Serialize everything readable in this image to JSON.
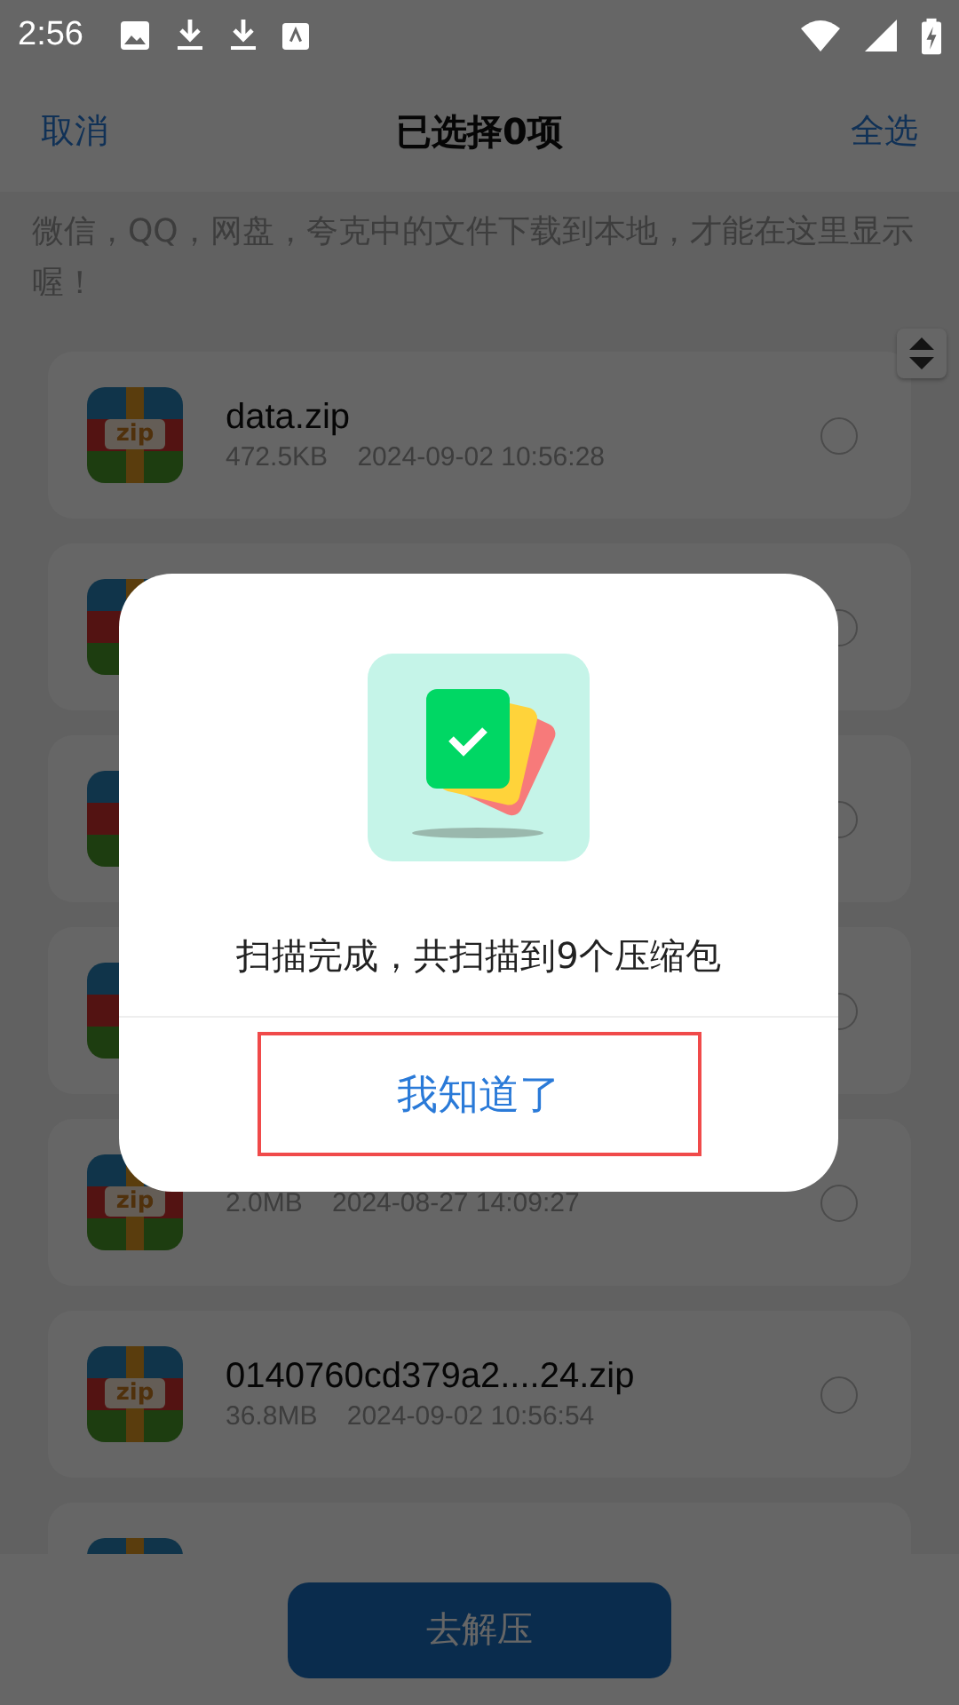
{
  "status_bar": {
    "time": "2:56"
  },
  "header": {
    "cancel": "取消",
    "title": "已选择0项",
    "select_all": "全选"
  },
  "notice": "微信，QQ，网盘，夸克中的文件下载到本地，才能在这里显示喔！",
  "files": [
    {
      "kind": "file",
      "icon_label": "zip",
      "name": "data.zip",
      "size": "472.5KB",
      "date": "2024-09-02 10:56:28",
      "selected": false
    },
    {
      "kind": "covered",
      "selected": false
    },
    {
      "kind": "covered",
      "selected": false
    },
    {
      "kind": "covered",
      "selected": false
    },
    {
      "kind": "file",
      "icon_label": "zip",
      "size": "2.0MB",
      "date": "2024-08-27 14:09:27",
      "selected": false
    },
    {
      "kind": "file",
      "icon_label": "zip",
      "name": "0140760cd379a2....24.zip",
      "size": "36.8MB",
      "date": "2024-09-02 10:56:54",
      "selected": false
    },
    {
      "kind": "cut"
    }
  ],
  "bottom_button": "去解压",
  "dialog": {
    "message": "扫描完成，共扫描到9个压缩包",
    "button": "我知道了"
  }
}
